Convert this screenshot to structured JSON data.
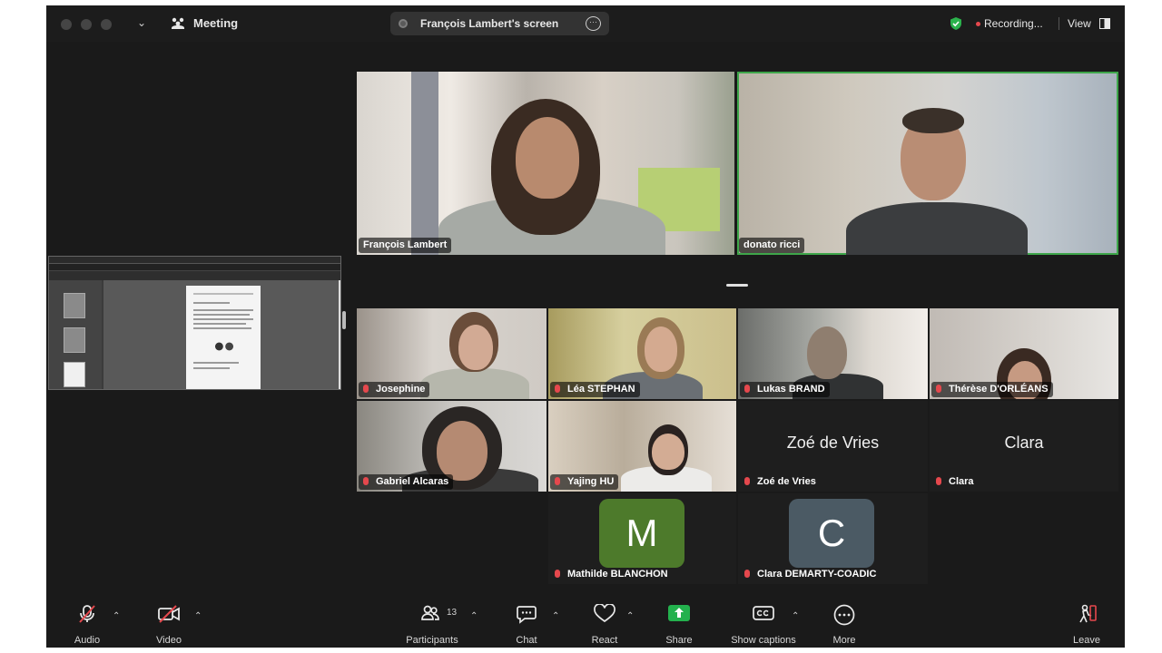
{
  "titlebar": {
    "meeting_label": "Meeting",
    "screen_share_label": "François Lambert's screen",
    "more_glyph": "···",
    "recording_label": "Recording...",
    "view_label": "View"
  },
  "featured_tiles": [
    {
      "name": "François Lambert",
      "active": false
    },
    {
      "name": "donato ricci",
      "active": true
    }
  ],
  "gallery_tiles": [
    {
      "name": "Josephine",
      "muted": true
    },
    {
      "name": "Léa STEPHAN",
      "muted": true
    },
    {
      "name": "Lukas BRAND",
      "muted": true
    },
    {
      "name": "Thérèse D'ORLÉANS",
      "muted": true
    },
    {
      "name": "Gabriel Alcaras",
      "muted": true
    },
    {
      "name": "Yajing HU",
      "muted": true
    },
    {
      "name": "Zoé de Vries",
      "display_name": "Zoé de Vries",
      "muted": true,
      "video": false
    },
    {
      "name": "Clara",
      "display_name": "Clara",
      "muted": true,
      "video": false
    },
    {
      "name": "Mathilde BLANCHON",
      "avatar_letter": "M",
      "avatar_color": "#4d7a2b",
      "muted": true,
      "video": false
    },
    {
      "name": "Clara DEMARTY-COADIC",
      "avatar_letter": "C",
      "avatar_color": "#4b5a64",
      "muted": true,
      "video": false
    }
  ],
  "toolbar": {
    "audio": "Audio",
    "video": "Video",
    "participants": "Participants",
    "participants_count": "13",
    "chat": "Chat",
    "react": "React",
    "share": "Share",
    "captions": "Show captions",
    "more": "More",
    "leave": "Leave"
  },
  "colors": {
    "active_speaker": "#3ea64a",
    "recording": "#e5484d",
    "share_green": "#23b14d",
    "muted_red": "#e5484d"
  },
  "icons": [
    "meeting-icon",
    "shield-check-icon",
    "view-grid-icon",
    "microphone-muted-icon",
    "video-off-icon",
    "participants-icon",
    "chat-icon",
    "heart-icon",
    "share-screen-icon",
    "captions-icon",
    "more-icon",
    "leave-icon"
  ]
}
